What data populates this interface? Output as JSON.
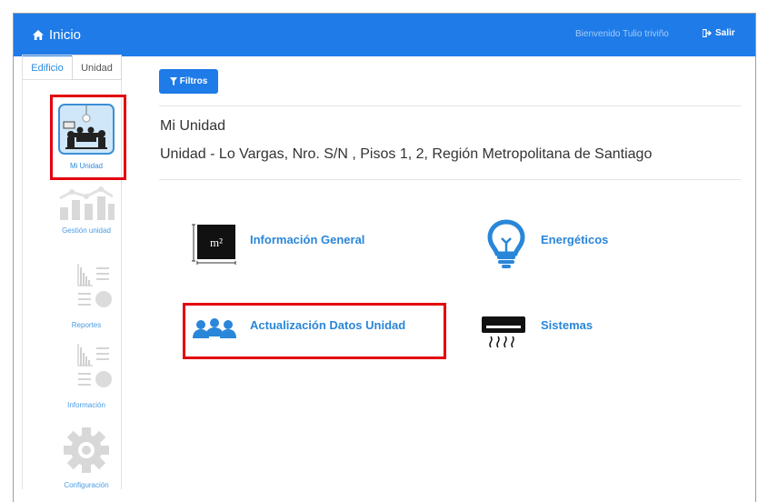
{
  "topbar": {
    "home_label": "Inicio",
    "welcome_text": "Bienvenido Tulio triviño",
    "logout_label": "Salir"
  },
  "sidebar": {
    "tabs": [
      "Edificio",
      "Unidad"
    ],
    "items": [
      {
        "label": "Mi Unidad",
        "icon": "unit-meeting-icon"
      },
      {
        "label": "Gestión unidad",
        "icon": "bar-chart-icon"
      },
      {
        "label": "Reportes",
        "icon": "report-icon"
      },
      {
        "label": "Información",
        "icon": "report-icon"
      },
      {
        "label": "Configuración",
        "icon": "gear-icon"
      }
    ]
  },
  "main": {
    "filter_label": "Filtros",
    "title": "Mi Unidad",
    "subtitle": "Unidad - Lo Vargas, Nro. S/N , Pisos 1, 2, Región Metropolitana de Santiago",
    "cards": [
      {
        "label": "Información General",
        "icon": "square-meter-icon"
      },
      {
        "label": "Energéticos",
        "icon": "lightbulb-icon"
      },
      {
        "label": "Actualización Datos Unidad",
        "icon": "users-icon"
      },
      {
        "label": "Sistemas",
        "icon": "air-conditioner-icon"
      }
    ],
    "m2_text": "m²"
  },
  "colors": {
    "accent": "#1e7be8",
    "link": "#2a86d9",
    "highlight": "#e3000e"
  }
}
